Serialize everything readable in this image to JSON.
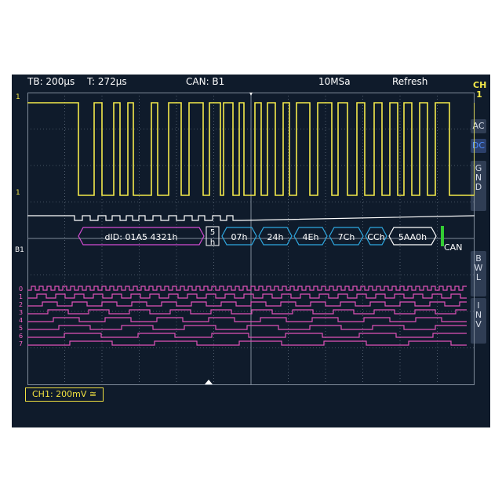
{
  "topbar": {
    "timebase": "TB: 200µs",
    "trigger_time": "T: 272µs",
    "bus": "CAN: B1",
    "sample_rate": "10MSa",
    "mode": "Refresh"
  },
  "channel": {
    "name_top": "CH",
    "name_num": "1"
  },
  "side_buttons": [
    {
      "label": "AC",
      "active": false
    },
    {
      "label": "DC",
      "active": true
    },
    {
      "label": "GND",
      "active": false
    },
    {
      "label": "BWL",
      "active": false
    },
    {
      "label": "INV",
      "active": false
    }
  ],
  "waveform": {
    "ch1_marker": "1",
    "bus_label": "B1",
    "bus_name": "CAN",
    "can_frames": [
      {
        "text": "dID: 01A5 4321h",
        "color": "#d24bd2"
      },
      {
        "text": "5",
        "color": "#ffffff"
      },
      {
        "text": "h",
        "color": "#ffffff"
      },
      {
        "text": "07h",
        "color": "#2fa8e0"
      },
      {
        "text": "24h",
        "color": "#2fa8e0"
      },
      {
        "text": "4Eh",
        "color": "#2fa8e0"
      },
      {
        "text": "7Ch",
        "color": "#2fa8e0"
      },
      {
        "text": "CCh",
        "color": "#2fa8e0"
      },
      {
        "text": "5AA0h",
        "color": "#ffffff"
      }
    ],
    "digital_lines": [
      "0",
      "1",
      "2",
      "3",
      "4",
      "5",
      "6",
      "7"
    ]
  },
  "status": {
    "label": "CH1: 200mV ≅"
  },
  "colors": {
    "background": "#0f1b2b",
    "grid": "#7f8b9a",
    "ch1": "#f4e94a",
    "can_id": "#d24bd2",
    "can_data": "#2fa8e0",
    "digital": "#e052b8",
    "ack": "#33cc33"
  }
}
